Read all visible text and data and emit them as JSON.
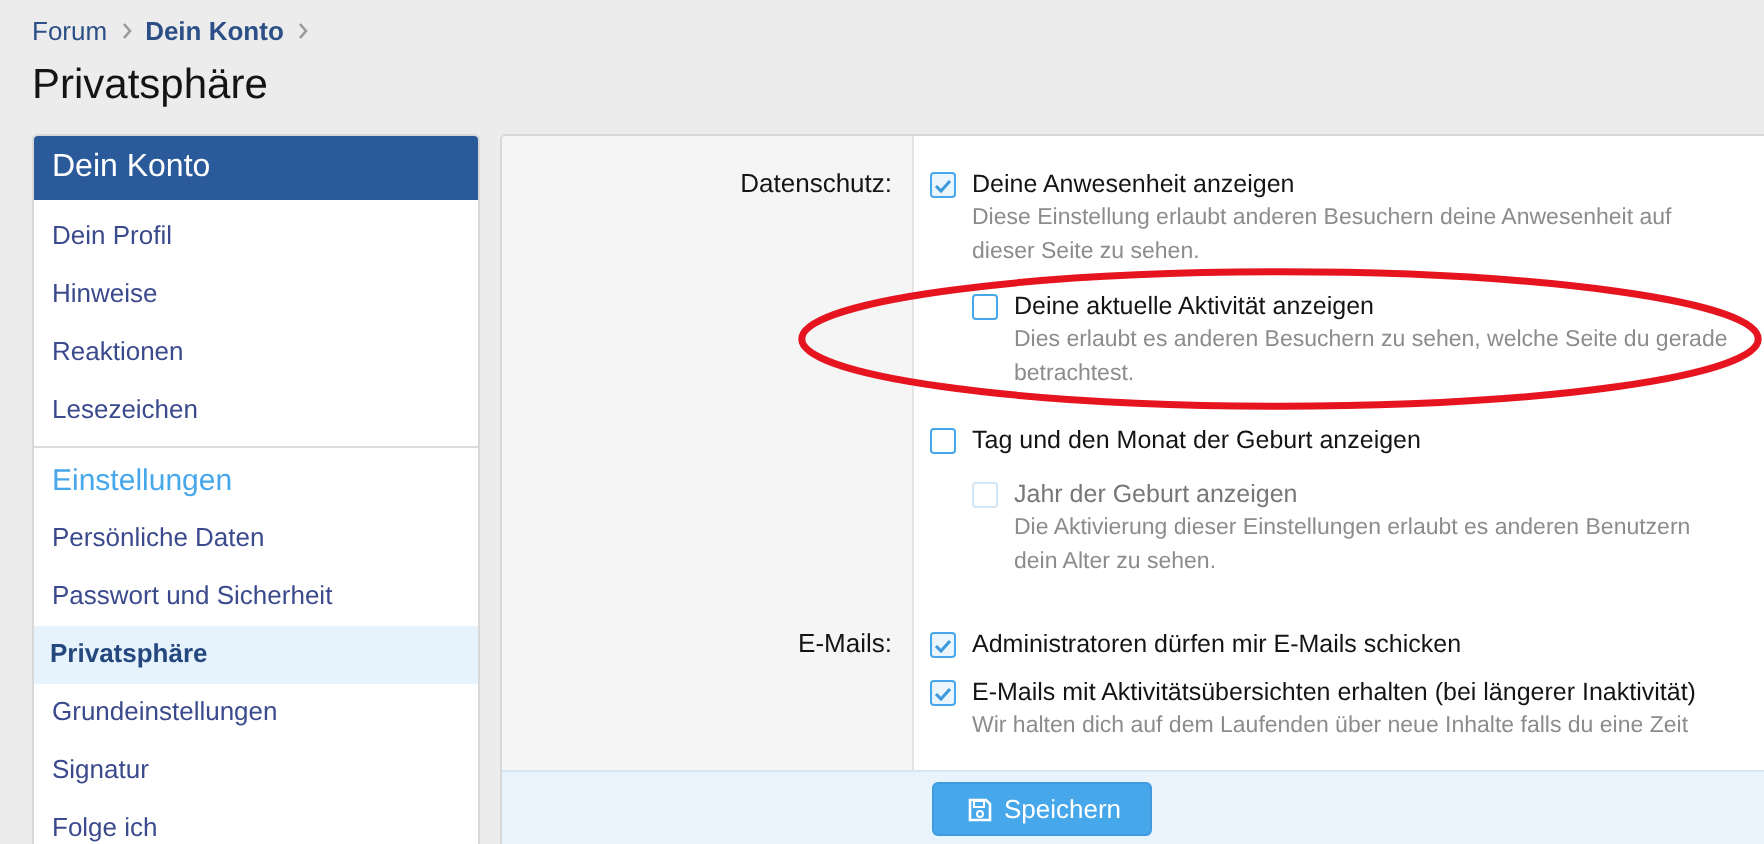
{
  "breadcrumb": [
    {
      "label": "Forum",
      "current": false
    },
    {
      "label": "Dein Konto",
      "current": true
    }
  ],
  "title": "Privatsphäre",
  "sidebar": {
    "header": "Dein Konto",
    "sections": [
      {
        "items": [
          {
            "label": "Dein Profil",
            "selected": false
          },
          {
            "label": "Hinweise",
            "selected": false
          },
          {
            "label": "Reaktionen",
            "selected": false
          },
          {
            "label": "Lesezeichen",
            "selected": false
          }
        ]
      },
      {
        "heading": "Einstellungen",
        "items": [
          {
            "label": "Persönliche Daten",
            "selected": false
          },
          {
            "label": "Passwort und Sicherheit",
            "selected": false
          },
          {
            "label": "Privatsphäre",
            "selected": true
          },
          {
            "label": "Grundeinstellungen",
            "selected": false
          },
          {
            "label": "Signatur",
            "selected": false
          },
          {
            "label": "Folge ich",
            "selected": false
          }
        ]
      }
    ]
  },
  "groups": [
    {
      "label": "Datenschutz:",
      "options": [
        {
          "label": "Deine Anwesenheit anzeigen",
          "checked": true,
          "disabled": false,
          "highlighted": false,
          "hint": "Diese Einstellung erlaubt anderen Besuchern deine Anwesenheit auf dieser Seite zu sehen.",
          "children": [
            {
              "label": "Deine aktuelle Aktivität anzeigen",
              "checked": false,
              "disabled": false,
              "highlighted": true,
              "hint": "Dies erlaubt es anderen Besuchern zu sehen, welche Seite du gerade betrachtest."
            }
          ]
        },
        {
          "label": "Tag und den Monat der Geburt anzeigen",
          "checked": false,
          "disabled": false,
          "highlighted": false,
          "children": [
            {
              "label": "Jahr der Geburt anzeigen",
              "checked": false,
              "disabled": true,
              "highlighted": false,
              "hint": "Die Aktivierung dieser Einstellungen erlaubt es anderen Benutzern dein Alter zu sehen."
            }
          ]
        }
      ]
    },
    {
      "label": "E-Mails:",
      "options": [
        {
          "label": "Administratoren dürfen mir E-Mails schicken",
          "checked": true,
          "disabled": false,
          "highlighted": false
        },
        {
          "label": "E-Mails mit Aktivitätsübersichten erhalten (bei längerer Inaktivität)",
          "checked": true,
          "disabled": false,
          "highlighted": false,
          "hint": "Wir halten dich auf dem Laufenden über neue Inhalte falls du eine Zeit"
        }
      ]
    }
  ],
  "save_button": "Speichern"
}
